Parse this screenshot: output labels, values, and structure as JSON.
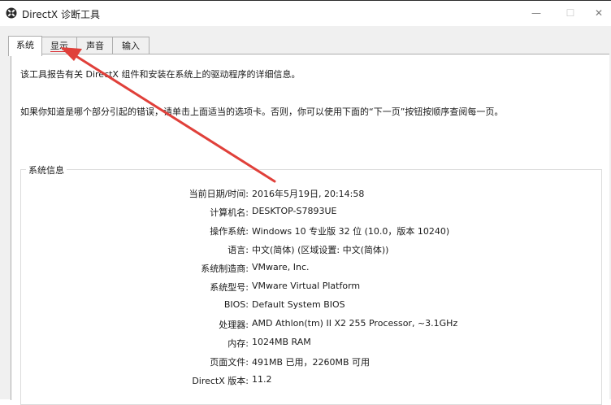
{
  "window": {
    "title": "DirectX 诊断工具",
    "controls": {
      "minimize": "—",
      "maximize": "☐",
      "close": "✕"
    }
  },
  "tabs": [
    {
      "label": "系统",
      "selected": true
    },
    {
      "label": "显示",
      "selected": false
    },
    {
      "label": "声音",
      "selected": false
    },
    {
      "label": "输入",
      "selected": false
    }
  ],
  "intro": {
    "line1": "该工具报告有关 DirectX 组件和安装在系统上的驱动程序的详细信息。",
    "line2": "如果你知道是哪个部分引起的错误，请单击上面适当的选项卡。否则，你可以使用下面的“下一页”按钮按顺序查阅每一页。"
  },
  "system_info": {
    "title": "系统信息",
    "rows": [
      {
        "label": "当前日期/时间:",
        "value": "2016年5月19日, 20:14:58"
      },
      {
        "label": "计算机名:",
        "value": "DESKTOP-S7893UE"
      },
      {
        "label": "操作系统:",
        "value": "Windows 10 专业版 32 位 (10.0，版本 10240)"
      },
      {
        "label": "语言:",
        "value": "中文(简体) (区域设置: 中文(简体))"
      },
      {
        "label": "系统制造商:",
        "value": "VMware, Inc."
      },
      {
        "label": "系统型号:",
        "value": "VMware Virtual Platform"
      },
      {
        "label": "BIOS:",
        "value": "Default System BIOS"
      },
      {
        "label": "处理器:",
        "value": "AMD Athlon(tm) II X2 255 Processor, ~3.1GHz"
      },
      {
        "label": "内存:",
        "value": "1024MB RAM"
      },
      {
        "label": "页面文件:",
        "value": "491MB 已用，2260MB 可用"
      },
      {
        "label": "DirectX 版本:",
        "value": "11.2"
      }
    ]
  },
  "colors": {
    "annotation_arrow": "#e0403a",
    "tab_underline": "#d9262c"
  }
}
